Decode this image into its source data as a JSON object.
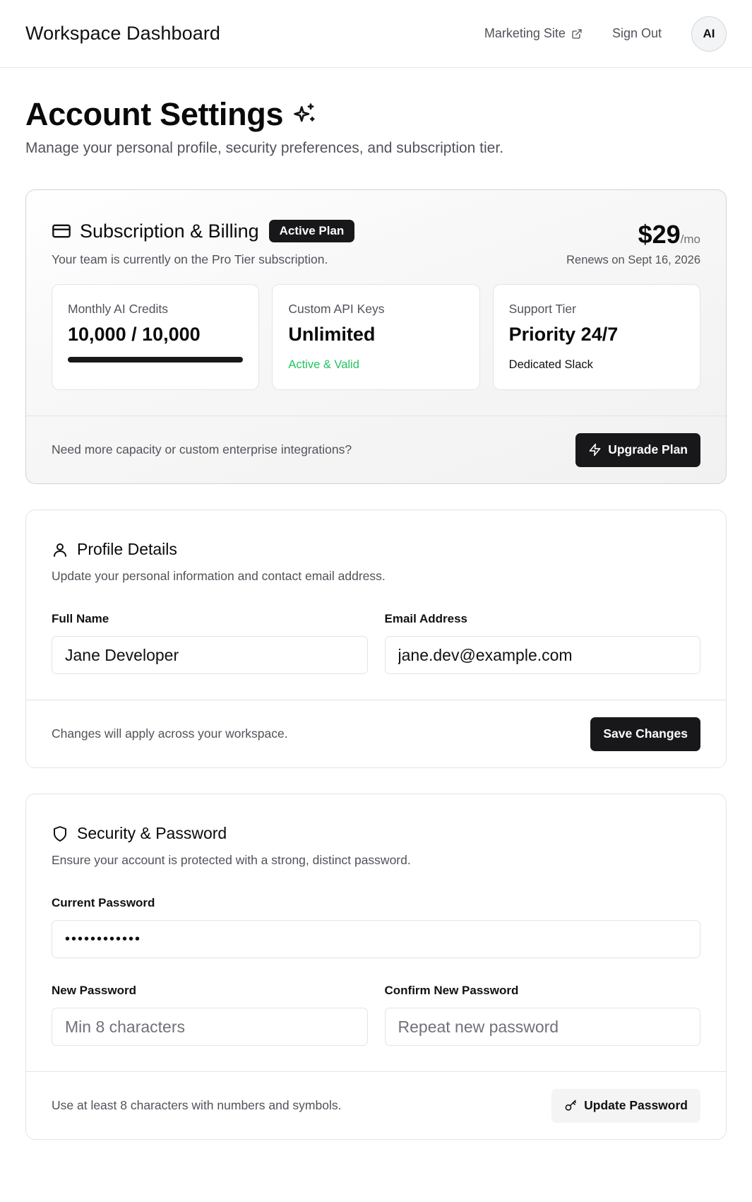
{
  "header": {
    "brand": "Workspace Dashboard",
    "marketing_link": "Marketing Site",
    "sign_out": "Sign Out",
    "avatar_initials": "AI"
  },
  "page": {
    "title": "Account Settings",
    "subtitle": "Manage your personal profile, security preferences, and subscription tier."
  },
  "billing": {
    "title": "Subscription & Billing",
    "badge": "Active Plan",
    "description": "Your team is currently on the Pro Tier subscription.",
    "price": "$29",
    "price_unit": "/mo",
    "renews": "Renews on Sept 16, 2026",
    "stats": [
      {
        "label": "Monthly AI Credits",
        "value": "10,000 / 10,000",
        "progress": 1.0
      },
      {
        "label": "Custom API Keys",
        "value": "Unlimited",
        "sub": "Active & Valid",
        "sub_color": "#22c55e"
      },
      {
        "label": "Support Tier",
        "value": "Priority 24/7",
        "sub": "Dedicated Slack"
      }
    ],
    "footer_note": "Need more capacity or custom enterprise integrations?",
    "upgrade_label": "Upgrade Plan"
  },
  "profile": {
    "title": "Profile Details",
    "description": "Update your personal information and contact email address.",
    "full_name_label": "Full Name",
    "full_name_value": "Jane Developer",
    "email_label": "Email Address",
    "email_value": "jane.dev@example.com",
    "footer_note": "Changes will apply across your workspace.",
    "save_label": "Save Changes"
  },
  "security": {
    "title": "Security & Password",
    "description": "Ensure your account is protected with a strong, distinct password.",
    "current_label": "Current Password",
    "current_value": "••••••••••••",
    "new_label": "New Password",
    "new_placeholder": "Min 8 characters",
    "confirm_label": "Confirm New Password",
    "confirm_placeholder": "Repeat new password",
    "footer_note": "Use at least 8 characters with numbers and symbols.",
    "update_label": "Update Password"
  },
  "icons": {
    "external": "external-link-icon",
    "sparkles": "sparkles-icon",
    "card": "credit-card-icon",
    "bolt": "zap-icon",
    "user": "user-icon",
    "shield": "shield-icon",
    "key": "key-icon"
  }
}
